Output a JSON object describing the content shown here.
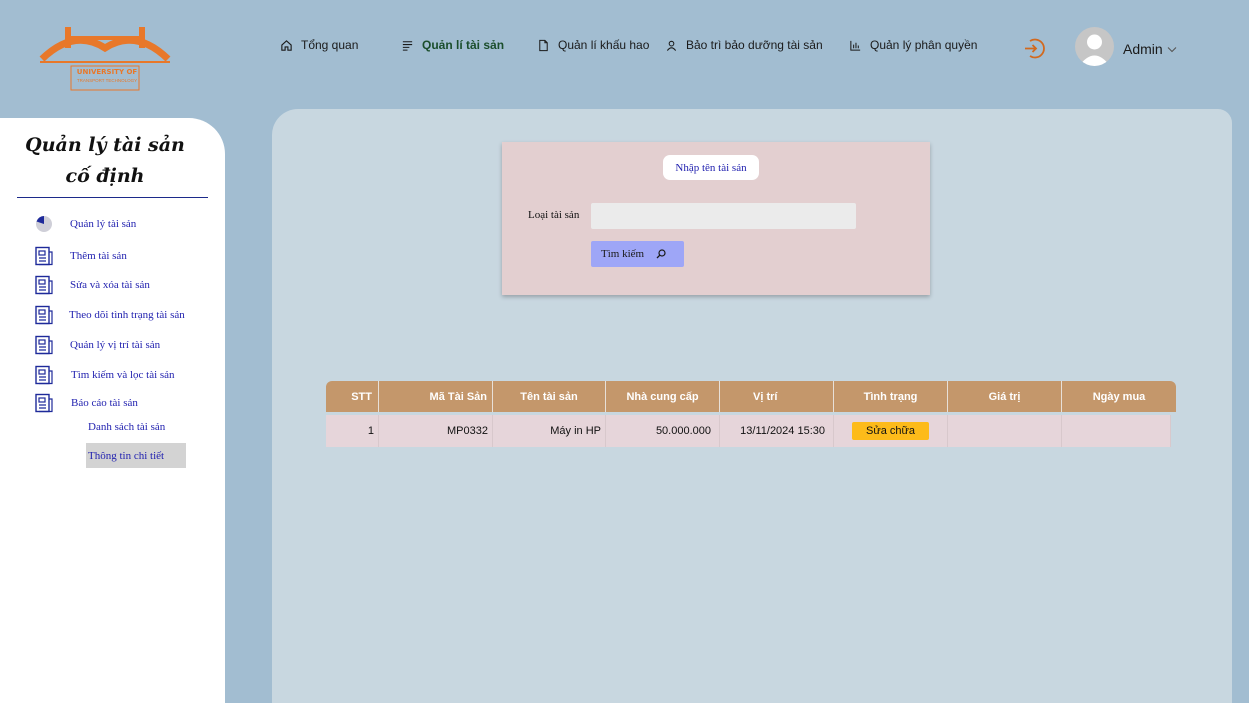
{
  "logo": {
    "line1": "UNIVERSITY OF",
    "line2": "TRANSPORT TECHNOLOGY"
  },
  "topnav": {
    "items": [
      {
        "label": "Tổng quan",
        "icon": "home-icon"
      },
      {
        "label": "Quản lí tài sản",
        "icon": "list-icon",
        "active": true
      },
      {
        "label": "Quản lí khấu hao",
        "icon": "document-icon"
      },
      {
        "label": "Bảo trì bảo dưỡng tài sản",
        "icon": "user-icon"
      },
      {
        "label": "Quản lý phân quyền",
        "icon": "bar-chart-icon"
      }
    ],
    "logout_icon": "logout-icon",
    "user": {
      "name": "Admin"
    }
  },
  "sidebar": {
    "title": "Quản lý tài sản cố định",
    "items": [
      {
        "label": "Quản lý tài sản",
        "icon": "pie-chart-icon"
      },
      {
        "label": "Thêm  tài sản",
        "icon": "form-icon"
      },
      {
        "label": "Sửa và xóa tài sản",
        "icon": "form-icon"
      },
      {
        "label": "Theo dõi tình trạng tài sản",
        "icon": "form-icon"
      },
      {
        "label": "Quản lý vị trí tài sản",
        "icon": "form-icon"
      },
      {
        "label": "Tìm kiếm và lọc tài sản",
        "icon": "form-icon"
      },
      {
        "label": "Báo cáo tài sản",
        "icon": "form-icon"
      }
    ],
    "subitems": [
      {
        "label": "Danh sách tài sản"
      },
      {
        "label": "Thông tin chi tiết",
        "selected": true
      }
    ]
  },
  "search": {
    "name_placeholder": "Nhập tên tài sản",
    "type_label": "Loại tài sản",
    "type_value": "",
    "button_label": "Tìm kiếm"
  },
  "table": {
    "headers": [
      "STT",
      "Mã Tài Sản",
      "Tên tài sản",
      "Nhà cung cấp",
      "Vị trí",
      "Tình trạng",
      "Giá trị",
      "Ngày mua"
    ],
    "rows": [
      {
        "stt": "1",
        "code": "MP0332",
        "name": "Máy in HP",
        "supplier": "50.000.000",
        "location": "13/11/2024  15:30",
        "status": "Sửa chữa",
        "value": "",
        "date": ""
      }
    ]
  },
  "colors": {
    "background": "#a2bdd1",
    "panel": "#c8d7e0",
    "table_header": "#c4976b",
    "row": "#e6d5da",
    "status_badge": "#fdbb1a",
    "search_button": "#9ea6f7",
    "sidebar_text": "#2323b0",
    "brand_orange": "#e8782a"
  }
}
